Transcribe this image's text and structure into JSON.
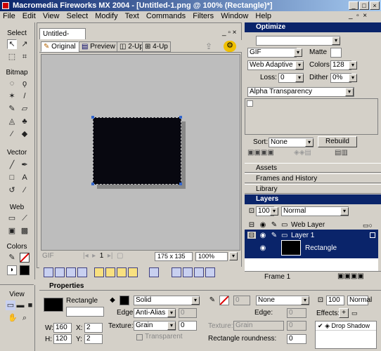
{
  "window": {
    "title": "Macromedia Fireworks MX 2004 - [Untitled-1.png @ 100% (Rectangle)*]"
  },
  "menu": [
    "File",
    "Edit",
    "View",
    "Select",
    "Modify",
    "Text",
    "Commands",
    "Filters",
    "Window",
    "Help"
  ],
  "tools": {
    "sections": {
      "select": "Select",
      "bitmap": "Bitmap",
      "vector": "Vector",
      "web": "Web",
      "colors": "Colors",
      "view": "View"
    }
  },
  "document": {
    "tab": "Untitled-1.png*",
    "views": [
      "Original",
      "Preview",
      "2-Up",
      "4-Up"
    ],
    "status": {
      "format": "GIF",
      "size": "175 x 135",
      "zoom": "100%",
      "frame": "1"
    }
  },
  "optimize": {
    "title": "Optimize",
    "format": "GIF",
    "matte_label": "Matte",
    "palette": "Web Adaptive",
    "colors_label": "Colors",
    "colors_value": "128",
    "loss_label": "Loss:",
    "loss_value": "0",
    "dither_label": "Dither",
    "dither_value": "0%",
    "transparency": "Alpha Transparency",
    "sort_label": "Sort:",
    "sort_value": "None",
    "rebuild": "Rebuild"
  },
  "panels": {
    "assets": "Assets",
    "frames": "Frames and History",
    "library": "Library",
    "layers": "Layers"
  },
  "layers": {
    "opacity": "100",
    "blend": "Normal",
    "items": [
      "Web Layer",
      "Layer 1",
      "Rectangle"
    ],
    "frame_label": "Frame 1"
  },
  "properties": {
    "title": "Properties",
    "object": "Rectangle",
    "fill": "Solid",
    "edge_label": "Edge:",
    "edge": "Anti-Alias",
    "edge_value": "0",
    "texture_label": "Texture:",
    "texture": "Grain",
    "texture_value": "0",
    "transparent": "Transparent",
    "stroke": "None",
    "stroke_size": "0",
    "stroke_edge_label": "Edge:",
    "stroke_edge_value": "0",
    "stroke_texture_label": "Texture:",
    "stroke_texture": "Grain",
    "stroke_texture_value": "0",
    "opacity": "100",
    "blend": "Normal",
    "effects_label": "Effects:",
    "effect_item": "Drop Shadow",
    "roundness_label": "Rectangle roundness:",
    "roundness_value": "0",
    "w_label": "W:",
    "w": "160",
    "h_label": "H:",
    "h": "120",
    "x_label": "X:",
    "x": "2",
    "y_label": "Y:",
    "y": "2"
  },
  "colors": {
    "fill": "#000000",
    "selection": "#3366cc",
    "title_bar": "#0a246a",
    "layer_selected": "#0a246a"
  }
}
